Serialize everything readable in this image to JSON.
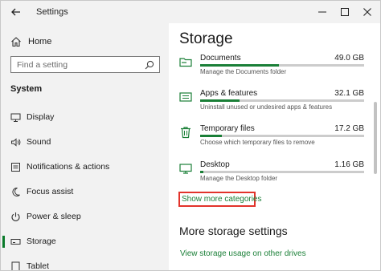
{
  "window": {
    "title": "Settings"
  },
  "sidebar": {
    "home_label": "Home",
    "search_placeholder": "Find a setting",
    "section_label": "System",
    "items": [
      {
        "label": "Display",
        "icon": "monitor-icon"
      },
      {
        "label": "Sound",
        "icon": "speaker-icon"
      },
      {
        "label": "Notifications & actions",
        "icon": "notifications-icon"
      },
      {
        "label": "Focus assist",
        "icon": "moon-icon"
      },
      {
        "label": "Power & sleep",
        "icon": "power-icon"
      },
      {
        "label": "Storage",
        "icon": "storage-icon",
        "active": true
      },
      {
        "label": "Tablet",
        "icon": "tablet-icon"
      }
    ]
  },
  "main": {
    "heading": "Storage",
    "categories": [
      {
        "name": "Documents",
        "size": "49.0 GB",
        "description": "Manage the Documents folder",
        "usage_fraction": 0.48,
        "icon": "folder-icon"
      },
      {
        "name": "Apps & features",
        "size": "32.1 GB",
        "description": "Uninstall unused or undesired apps & features",
        "usage_fraction": 0.24,
        "icon": "apps-icon"
      },
      {
        "name": "Temporary files",
        "size": "17.2 GB",
        "description": "Choose which temporary files to remove",
        "usage_fraction": 0.13,
        "icon": "trash-icon"
      },
      {
        "name": "Desktop",
        "size": "1.16 GB",
        "description": "Manage the Desktop folder",
        "usage_fraction": 0.02,
        "icon": "desktop-icon"
      }
    ],
    "show_more_label": "Show more categories",
    "more_settings_heading": "More storage settings",
    "other_drives_link": "View storage usage on other drives"
  },
  "colors": {
    "accent": "#1a7f37",
    "highlight_box": "#e2332b",
    "sidebar_bg": "#f2f2f2"
  }
}
